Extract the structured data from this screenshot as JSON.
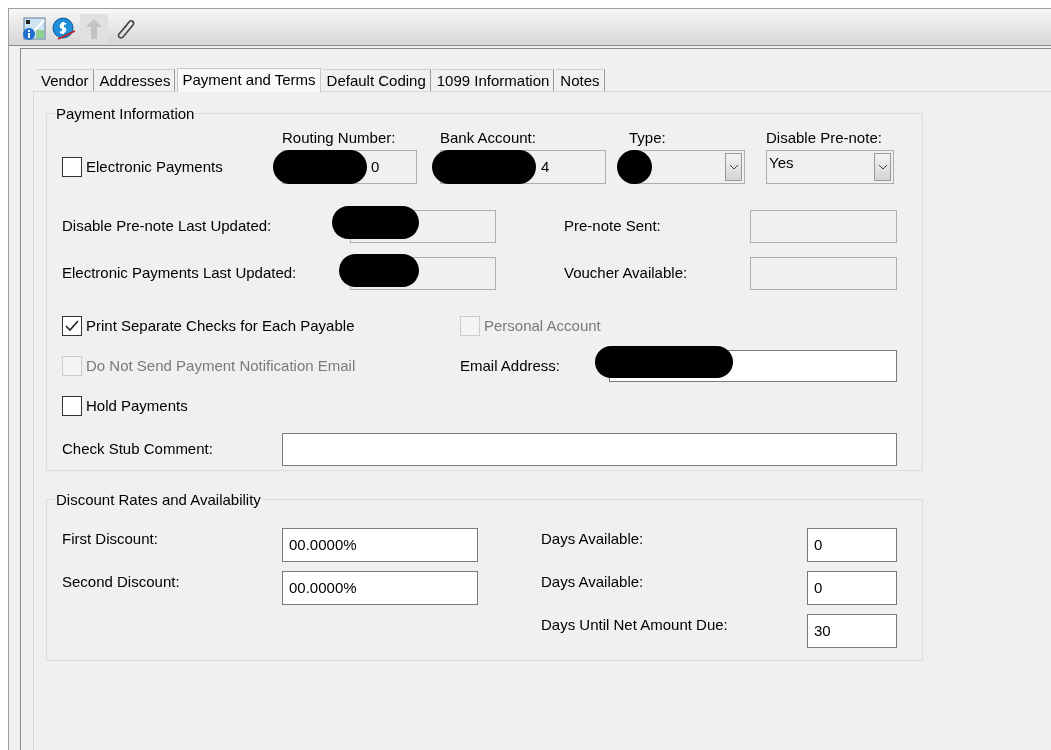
{
  "toolbar": [
    {
      "kind": "info-grid",
      "disabled": false
    },
    {
      "kind": "dollar",
      "disabled": false
    },
    {
      "kind": "merge",
      "disabled": true
    },
    {
      "kind": "clip",
      "disabled": false
    }
  ],
  "tabs": [
    {
      "label": "Vendor",
      "selected": false
    },
    {
      "label": "Addresses",
      "selected": false
    },
    {
      "label": "Payment and Terms",
      "selected": true
    },
    {
      "label": "Default Coding",
      "selected": false
    },
    {
      "label": "1099 Information",
      "selected": false
    },
    {
      "label": "Notes",
      "selected": false
    }
  ],
  "payment_information": {
    "title": "Payment Information",
    "electronic_payments": {
      "label": "Electronic Payments",
      "checked": false,
      "disabled": false
    },
    "fields": [
      {
        "kind": "text",
        "label": "Routing Number:",
        "value": "0",
        "redacted": true
      },
      {
        "kind": "text",
        "label": "Bank Account:",
        "value": "4",
        "redacted": true
      },
      {
        "kind": "select",
        "label": "Type:",
        "redacted": true
      },
      {
        "kind": "select",
        "label": "Disable Pre-note:",
        "value": "Yes"
      }
    ],
    "disable_prenote_last_updated": {
      "label": "Disable Pre-note Last Updated:",
      "redacted": true,
      "editable": false
    },
    "prenote_sent": {
      "label": "Pre-note Sent:",
      "editable": false
    },
    "electronic_payments_last_updated": {
      "label": "Electronic Payments Last Updated:",
      "redacted": true,
      "editable": false
    },
    "voucher_available": {
      "label": "Voucher Available:",
      "editable": false
    },
    "print_separate_checks": {
      "label": "Print Separate Checks for Each Payable",
      "checked": true,
      "disabled": false
    },
    "personal_account": {
      "label": "Personal Account",
      "checked": false,
      "disabled": true
    },
    "do_not_send_notification": {
      "label": "Do Not Send Payment Notification Email",
      "checked": false,
      "disabled": true
    },
    "email_address": {
      "label": "Email Address:",
      "redacted": true,
      "editable": true
    },
    "hold_payments": {
      "label": "Hold Payments",
      "checked": false,
      "disabled": false
    },
    "check_stub_comment": {
      "label": "Check Stub Comment:",
      "editable": true
    }
  },
  "discount_rates": {
    "title": "Discount Rates and Availability",
    "rows": [
      {
        "left": {
          "label": "First Discount:",
          "value": "00.0000%"
        },
        "right": {
          "label": "Days Available:",
          "value": "0"
        }
      },
      {
        "left": {
          "label": "Second Discount:",
          "value": "00.0000%"
        },
        "right": {
          "label": "Days Available:",
          "value": "0"
        }
      },
      {
        "right": {
          "label": "Days Until Net Amount Due:",
          "value": "30"
        }
      }
    ]
  }
}
